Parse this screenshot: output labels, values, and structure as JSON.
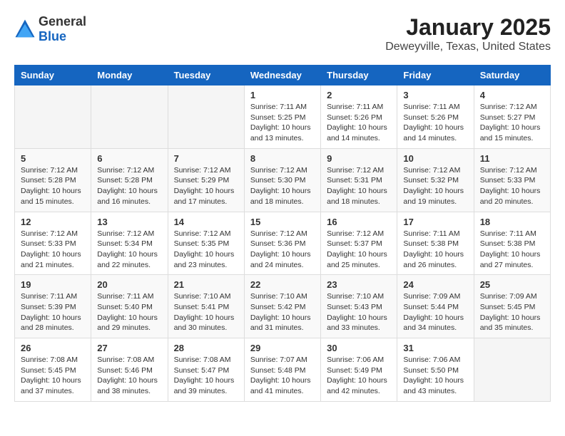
{
  "logo": {
    "text_general": "General",
    "text_blue": "Blue"
  },
  "title": "January 2025",
  "subtitle": "Deweyville, Texas, United States",
  "days_of_week": [
    "Sunday",
    "Monday",
    "Tuesday",
    "Wednesday",
    "Thursday",
    "Friday",
    "Saturday"
  ],
  "weeks": [
    [
      {
        "day": "",
        "info": ""
      },
      {
        "day": "",
        "info": ""
      },
      {
        "day": "",
        "info": ""
      },
      {
        "day": "1",
        "info": "Sunrise: 7:11 AM\nSunset: 5:25 PM\nDaylight: 10 hours\nand 13 minutes."
      },
      {
        "day": "2",
        "info": "Sunrise: 7:11 AM\nSunset: 5:26 PM\nDaylight: 10 hours\nand 14 minutes."
      },
      {
        "day": "3",
        "info": "Sunrise: 7:11 AM\nSunset: 5:26 PM\nDaylight: 10 hours\nand 14 minutes."
      },
      {
        "day": "4",
        "info": "Sunrise: 7:12 AM\nSunset: 5:27 PM\nDaylight: 10 hours\nand 15 minutes."
      }
    ],
    [
      {
        "day": "5",
        "info": "Sunrise: 7:12 AM\nSunset: 5:28 PM\nDaylight: 10 hours\nand 15 minutes."
      },
      {
        "day": "6",
        "info": "Sunrise: 7:12 AM\nSunset: 5:28 PM\nDaylight: 10 hours\nand 16 minutes."
      },
      {
        "day": "7",
        "info": "Sunrise: 7:12 AM\nSunset: 5:29 PM\nDaylight: 10 hours\nand 17 minutes."
      },
      {
        "day": "8",
        "info": "Sunrise: 7:12 AM\nSunset: 5:30 PM\nDaylight: 10 hours\nand 18 minutes."
      },
      {
        "day": "9",
        "info": "Sunrise: 7:12 AM\nSunset: 5:31 PM\nDaylight: 10 hours\nand 18 minutes."
      },
      {
        "day": "10",
        "info": "Sunrise: 7:12 AM\nSunset: 5:32 PM\nDaylight: 10 hours\nand 19 minutes."
      },
      {
        "day": "11",
        "info": "Sunrise: 7:12 AM\nSunset: 5:33 PM\nDaylight: 10 hours\nand 20 minutes."
      }
    ],
    [
      {
        "day": "12",
        "info": "Sunrise: 7:12 AM\nSunset: 5:33 PM\nDaylight: 10 hours\nand 21 minutes."
      },
      {
        "day": "13",
        "info": "Sunrise: 7:12 AM\nSunset: 5:34 PM\nDaylight: 10 hours\nand 22 minutes."
      },
      {
        "day": "14",
        "info": "Sunrise: 7:12 AM\nSunset: 5:35 PM\nDaylight: 10 hours\nand 23 minutes."
      },
      {
        "day": "15",
        "info": "Sunrise: 7:12 AM\nSunset: 5:36 PM\nDaylight: 10 hours\nand 24 minutes."
      },
      {
        "day": "16",
        "info": "Sunrise: 7:12 AM\nSunset: 5:37 PM\nDaylight: 10 hours\nand 25 minutes."
      },
      {
        "day": "17",
        "info": "Sunrise: 7:11 AM\nSunset: 5:38 PM\nDaylight: 10 hours\nand 26 minutes."
      },
      {
        "day": "18",
        "info": "Sunrise: 7:11 AM\nSunset: 5:38 PM\nDaylight: 10 hours\nand 27 minutes."
      }
    ],
    [
      {
        "day": "19",
        "info": "Sunrise: 7:11 AM\nSunset: 5:39 PM\nDaylight: 10 hours\nand 28 minutes."
      },
      {
        "day": "20",
        "info": "Sunrise: 7:11 AM\nSunset: 5:40 PM\nDaylight: 10 hours\nand 29 minutes."
      },
      {
        "day": "21",
        "info": "Sunrise: 7:10 AM\nSunset: 5:41 PM\nDaylight: 10 hours\nand 30 minutes."
      },
      {
        "day": "22",
        "info": "Sunrise: 7:10 AM\nSunset: 5:42 PM\nDaylight: 10 hours\nand 31 minutes."
      },
      {
        "day": "23",
        "info": "Sunrise: 7:10 AM\nSunset: 5:43 PM\nDaylight: 10 hours\nand 33 minutes."
      },
      {
        "day": "24",
        "info": "Sunrise: 7:09 AM\nSunset: 5:44 PM\nDaylight: 10 hours\nand 34 minutes."
      },
      {
        "day": "25",
        "info": "Sunrise: 7:09 AM\nSunset: 5:45 PM\nDaylight: 10 hours\nand 35 minutes."
      }
    ],
    [
      {
        "day": "26",
        "info": "Sunrise: 7:08 AM\nSunset: 5:45 PM\nDaylight: 10 hours\nand 37 minutes."
      },
      {
        "day": "27",
        "info": "Sunrise: 7:08 AM\nSunset: 5:46 PM\nDaylight: 10 hours\nand 38 minutes."
      },
      {
        "day": "28",
        "info": "Sunrise: 7:08 AM\nSunset: 5:47 PM\nDaylight: 10 hours\nand 39 minutes."
      },
      {
        "day": "29",
        "info": "Sunrise: 7:07 AM\nSunset: 5:48 PM\nDaylight: 10 hours\nand 41 minutes."
      },
      {
        "day": "30",
        "info": "Sunrise: 7:06 AM\nSunset: 5:49 PM\nDaylight: 10 hours\nand 42 minutes."
      },
      {
        "day": "31",
        "info": "Sunrise: 7:06 AM\nSunset: 5:50 PM\nDaylight: 10 hours\nand 43 minutes."
      },
      {
        "day": "",
        "info": ""
      }
    ]
  ]
}
